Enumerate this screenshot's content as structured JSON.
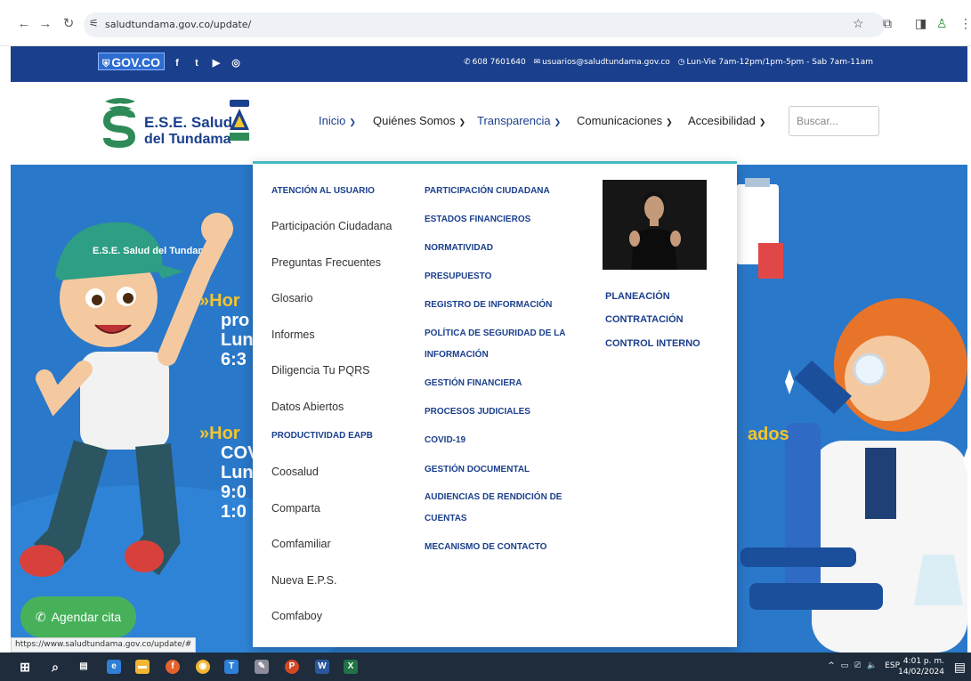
{
  "browser": {
    "url": "saludtundama.gov.co/update/"
  },
  "topbar": {
    "gov_logo": "GOV.CO",
    "phone": "608 7601640",
    "email": "usuarios@saludtundama.gov.co",
    "hours": "Lun-Vie 7am-12pm/1pm-5pm - Sab 7am-11am"
  },
  "brand": {
    "line1": "E.S.E. Salud",
    "line2": "del Tundama",
    "primary_color": "#1a3f8c",
    "accent_color": "#44b8c4"
  },
  "nav": {
    "items": [
      {
        "label": "Inicio",
        "icon": "chevron-down-icon"
      },
      {
        "label": "Quiénes Somos",
        "icon": "chevron-down-icon"
      },
      {
        "label": "Transparencia",
        "icon": "chevron-down-icon"
      },
      {
        "label": "Comunicaciones",
        "icon": "chevron-down-icon"
      },
      {
        "label": "Accesibilidad",
        "icon": "chevron-down-icon"
      }
    ],
    "search_placeholder": "Buscar..."
  },
  "mega_menu": {
    "col1_header": "ATENCIÓN AL USUARIO",
    "col1_links": [
      "Participación Ciudadana",
      "Preguntas Frecuentes",
      "Glosario",
      "Informes",
      "Diligencia Tu PQRS",
      "Datos Abiertos"
    ],
    "col1_header2": "PRODUCTIVIDAD EAPB",
    "col1_links2": [
      "Coosalud",
      "Comparta",
      "Comfamiliar",
      "Nueva E.P.S.",
      "Comfaboy"
    ],
    "col2": [
      "PARTICIPACIÓN CIUDADANA",
      "ESTADOS FINANCIEROS",
      "NORMATIVIDAD",
      "PRESUPUESTO",
      "REGISTRO DE INFORMACIÓN",
      "POLÍTICA DE SEGURIDAD DE LA",
      "INFORMACIÓN",
      "GESTIÓN FINANCIERA",
      "PROCESOS JUDICIALES",
      "COVID-19",
      "GESTIÓN DOCUMENTAL",
      "AUDIENCIAS DE RENDICIÓN DE",
      "CUENTAS",
      "MECANISMO DE CONTACTO"
    ],
    "col3": [
      "PLANEACIÓN",
      "CONTRATACIÓN",
      "CONTROL INTERNO"
    ]
  },
  "hero": {
    "lines": [
      "Hor",
      "pro",
      "Lun",
      "6:3",
      "Hor",
      "COV",
      "Lun",
      "9:0",
      "1:0"
    ],
    "right_text": "ados",
    "mascot_cap": "E.S.E. Salud del Tundama"
  },
  "whatsapp": {
    "label": "Agendar cita"
  },
  "status_bar": {
    "link": "https://www.saludtundama.gov.co/update/#"
  },
  "taskbar": {
    "language": "ESP",
    "time": "4:01 p. m.",
    "date": "14/02/2024"
  }
}
